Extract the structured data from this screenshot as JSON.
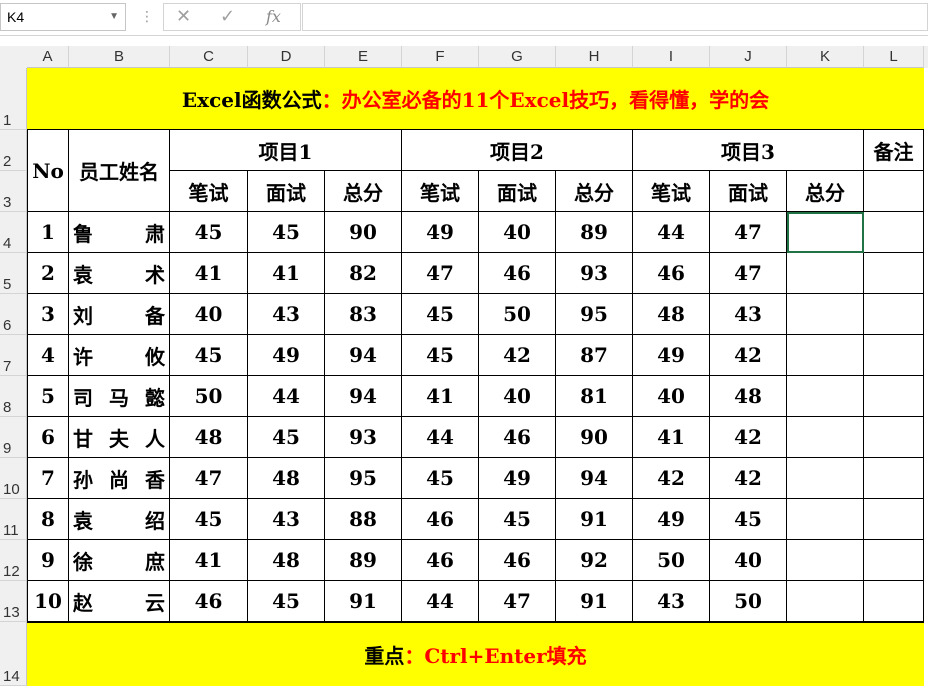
{
  "formula_bar": {
    "name_box": "K4",
    "cancel_icon": "✕",
    "enter_icon": "✓",
    "fx_label": "fx",
    "formula_value": ""
  },
  "columns": [
    "A",
    "B",
    "C",
    "D",
    "E",
    "F",
    "G",
    "H",
    "I",
    "J",
    "K",
    "L"
  ],
  "rows": [
    "1",
    "2",
    "3",
    "4",
    "5",
    "6",
    "7",
    "8",
    "9",
    "10",
    "11",
    "12",
    "13",
    "14"
  ],
  "title": {
    "prefix": "Excel函数公式",
    "colon": "：",
    "text": "办公室必备的11个Excel技巧，看得懂，学的会"
  },
  "header": {
    "no": "No",
    "name": "员工姓名",
    "project1": "项目1",
    "project2": "项目2",
    "project3": "项目3",
    "remark": "备注",
    "sub": [
      "笔试",
      "面试",
      "总分",
      "笔试",
      "面试",
      "总分",
      "笔试",
      "面试",
      "总分"
    ]
  },
  "table": [
    [
      "1",
      "鲁　　肃",
      "45",
      "45",
      "90",
      "49",
      "40",
      "89",
      "44",
      "47",
      "",
      ""
    ],
    [
      "2",
      "袁　　术",
      "41",
      "41",
      "82",
      "47",
      "46",
      "93",
      "46",
      "47",
      "",
      ""
    ],
    [
      "3",
      "刘　　备",
      "40",
      "43",
      "83",
      "45",
      "50",
      "95",
      "48",
      "43",
      "",
      ""
    ],
    [
      "4",
      "许　　攸",
      "45",
      "49",
      "94",
      "45",
      "42",
      "87",
      "49",
      "42",
      "",
      ""
    ],
    [
      "5",
      "司 马 懿",
      "50",
      "44",
      "94",
      "41",
      "40",
      "81",
      "40",
      "48",
      "",
      ""
    ],
    [
      "6",
      "甘 夫 人",
      "48",
      "45",
      "93",
      "44",
      "46",
      "90",
      "41",
      "42",
      "",
      ""
    ],
    [
      "7",
      "孙 尚 香",
      "47",
      "48",
      "95",
      "45",
      "49",
      "94",
      "42",
      "42",
      "",
      ""
    ],
    [
      "8",
      "袁　　绍",
      "45",
      "43",
      "88",
      "46",
      "45",
      "91",
      "49",
      "45",
      "",
      ""
    ],
    [
      "9",
      "徐　　庶",
      "41",
      "48",
      "89",
      "46",
      "46",
      "92",
      "50",
      "40",
      "",
      ""
    ],
    [
      "10",
      "赵　　云",
      "46",
      "45",
      "91",
      "44",
      "47",
      "91",
      "43",
      "50",
      "",
      ""
    ]
  ],
  "footer": {
    "label": "重点",
    "colon": "：",
    "text": "Ctrl+Enter填充"
  },
  "colors": {
    "highlight": "#ffff00",
    "accent_red": "#ff0000",
    "header_bg": "#f0f0f0"
  }
}
